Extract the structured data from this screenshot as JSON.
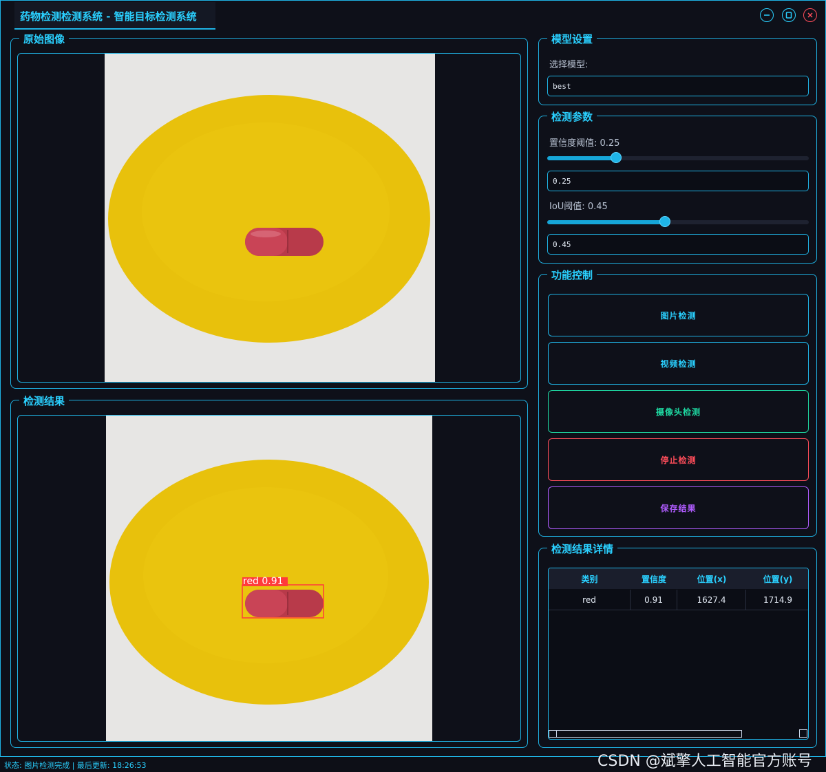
{
  "window": {
    "title": "药物检测检测系统 - 智能目标检测系统"
  },
  "original_panel": {
    "title": "原始图像"
  },
  "result_panel": {
    "title": "检测结果",
    "detection_label": "red  0.91"
  },
  "model_settings": {
    "title": "模型设置",
    "select_label": "选择模型:",
    "selected_model": "best"
  },
  "detection_params": {
    "title": "检测参数",
    "confidence_label": "置信度阈值: 0.25",
    "confidence_value": "0.25",
    "confidence_level": 0.25,
    "iou_label": "IoU阈值: 0.45",
    "iou_value": "0.45",
    "iou_level": 0.45
  },
  "controls": {
    "title": "功能控制",
    "image_detect": "图片检测",
    "video_detect": "视频检测",
    "camera_detect": "摄像头检测",
    "stop_detect": "停止检测",
    "save_results": "保存结果"
  },
  "results_detail": {
    "title": "检测结果详情",
    "columns": [
      "类别",
      "置信度",
      "位置(x)",
      "位置(y)"
    ],
    "rows": [
      [
        "red",
        "0.91",
        "1627.4",
        "1714.9"
      ]
    ]
  },
  "status": {
    "text": "状态: 图片检测完成 | 最后更新: 18:26:53"
  },
  "watermark": "CSDN @斌擎人工智能官方账号",
  "colors": {
    "accent": "#1fb4e6",
    "stop": "#ff4d5a",
    "camera": "#1ed6a0",
    "save": "#b05cff"
  }
}
